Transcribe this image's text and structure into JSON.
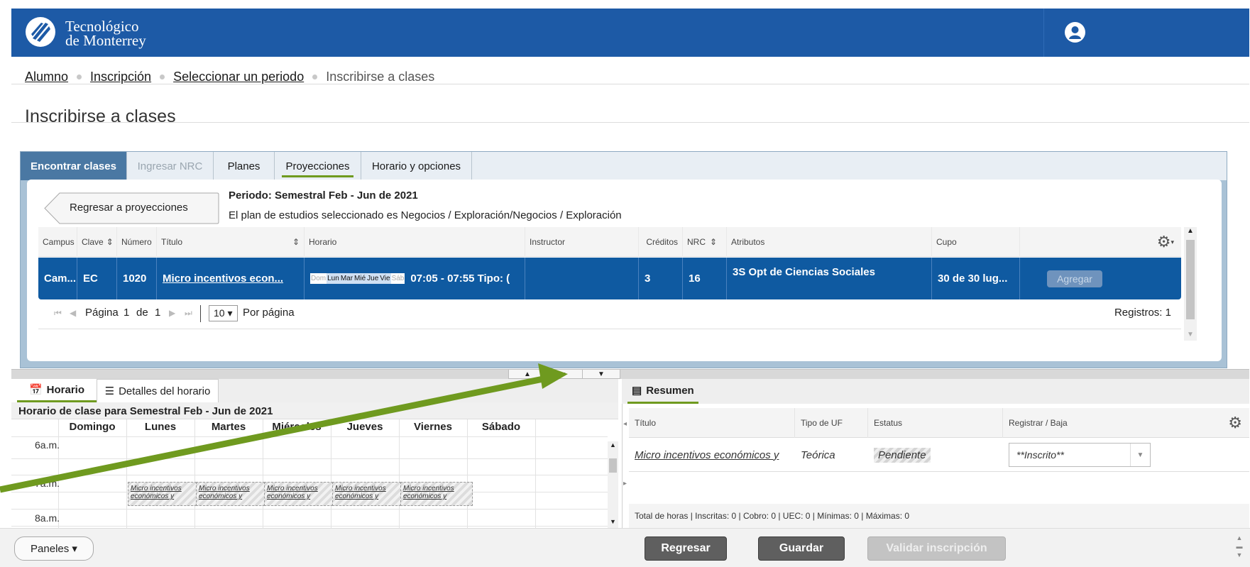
{
  "header": {
    "logo_line1": "Tecnológico",
    "logo_line2": "de Monterrey"
  },
  "breadcrumb": {
    "items": [
      "Alumno",
      "Inscripción",
      "Seleccionar un periodo"
    ],
    "current": "Inscribirse a clases"
  },
  "page": {
    "title": "Inscribirse a clases"
  },
  "tabs": [
    {
      "label": "Encontrar clases"
    },
    {
      "label": "Ingresar NRC"
    },
    {
      "label": "Planes"
    },
    {
      "label": "Proyecciones"
    },
    {
      "label": "Horario y opciones"
    }
  ],
  "search": {
    "back_label": "Regresar a proyecciones",
    "periodo": "Periodo: Semestral Feb - Jun de 2021",
    "plan": "El plan de estudios seleccionado es Negocios / Exploración/Negocios / Exploración"
  },
  "results": {
    "columns": [
      "Campus",
      "Clave",
      "Número",
      "Título",
      "Horario",
      "Instructor",
      "Créditos",
      "NRC",
      "Atributos",
      "Cupo"
    ],
    "row": {
      "campus": "Cam...",
      "clave": "EC",
      "numero": "1020",
      "titulo": "Micro incentivos econ...",
      "days": [
        "Dom",
        "Lun",
        "Mar",
        "Mié",
        "Jue",
        "Vie",
        "Sáb"
      ],
      "horario": "07:05 - 07:55 Tipo: (",
      "creditos": "3",
      "nrc": "16",
      "atributos": "3S Opt de Ciencias Sociales",
      "cupo": "30 de 30 lug...",
      "add_label": "Agregar"
    },
    "pager": {
      "pagina_label": "Página",
      "page": "1",
      "de": "de",
      "total": "1",
      "per_page": "10 ▾",
      "per_page_label": "Por página",
      "registros": "Registros: 1"
    }
  },
  "schedule": {
    "tabs": [
      "Horario",
      "Detalles del horario"
    ],
    "subtitle": "Horario de clase para Semestral Feb - Jun de 2021",
    "days": [
      "Domingo",
      "Lunes",
      "Martes",
      "Miércoles",
      "Jueves",
      "Viernes",
      "Sábado"
    ],
    "hours": [
      "6a.m.",
      "7a.m.",
      "8a.m."
    ],
    "event_text": "Micro incentivos económicos y"
  },
  "summary": {
    "tab": "Resumen",
    "columns": [
      "Título",
      "Tipo de UF",
      "Estatus",
      "Registrar / Baja"
    ],
    "row": {
      "titulo": "Micro incentivos económicos y",
      "tipo": "Teórica",
      "estatus": "Pendiente",
      "registrar": "**Inscrito**"
    },
    "footer": "Total de horas | Inscritas: 0 | Cobro: 0 | UEC: 0 | Mínimas: 0 | Máximas: 0"
  },
  "bottom": {
    "panels_label": "Paneles ▾",
    "regresar": "Regresar",
    "guardar": "Guardar",
    "validar": "Validar inscripción"
  },
  "colors": {
    "header": "#1d5aa6",
    "selected_row": "#0f5aa1",
    "arrow": "#6f9a1f"
  }
}
